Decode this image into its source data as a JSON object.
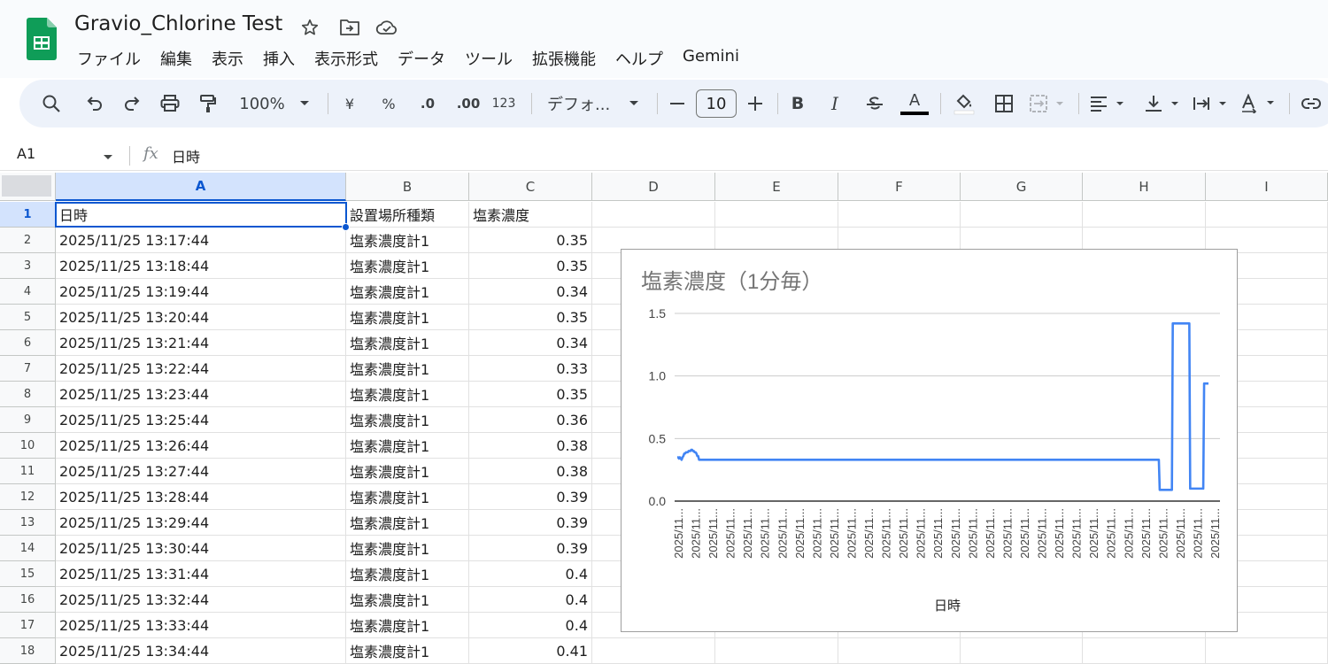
{
  "app": {
    "doc_title": "Gravio_Chlorine Test",
    "menu": [
      "ファイル",
      "編集",
      "表示",
      "挿入",
      "表示形式",
      "データ",
      "ツール",
      "拡張機能",
      "ヘルプ",
      "Gemini"
    ],
    "brand_color": "#0f9d58"
  },
  "toolbar": {
    "zoom": "100%",
    "currency": "¥",
    "percent": "%",
    "decimal_decrease": ".0",
    "decimal_increase": ".00",
    "number_format": "123",
    "font_name": "デフォ...",
    "font_size": "10",
    "bold": "B",
    "italic": "I",
    "text_color_glyph": "A",
    "icons": [
      "search-icon",
      "undo-icon",
      "redo-icon",
      "print-icon",
      "paint-format-icon",
      "zoom-caret-icon",
      "font-caret-icon",
      "minus-icon",
      "plus-icon",
      "strikethrough-icon",
      "fill-color-icon",
      "borders-icon",
      "merge-cells-icon",
      "align-icon",
      "valign-icon",
      "text-wrap-icon",
      "text-rotate-icon",
      "link-icon"
    ]
  },
  "formula_bar": {
    "name_box": "A1",
    "fx": "fx",
    "formula": "日時"
  },
  "sheet": {
    "columns": [
      "A",
      "B",
      "C",
      "D",
      "E",
      "F",
      "G",
      "H",
      "I"
    ],
    "rows": [
      {
        "num": "1",
        "a": "日時",
        "b": "設置場所種類",
        "c": "塩素濃度"
      },
      {
        "num": "2",
        "a": "2025/11/25 13:17:44",
        "b": "塩素濃度計1",
        "c": "0.35"
      },
      {
        "num": "3",
        "a": "2025/11/25 13:18:44",
        "b": "塩素濃度計1",
        "c": "0.35"
      },
      {
        "num": "4",
        "a": "2025/11/25 13:19:44",
        "b": "塩素濃度計1",
        "c": "0.34"
      },
      {
        "num": "5",
        "a": "2025/11/25 13:20:44",
        "b": "塩素濃度計1",
        "c": "0.35"
      },
      {
        "num": "6",
        "a": "2025/11/25 13:21:44",
        "b": "塩素濃度計1",
        "c": "0.34"
      },
      {
        "num": "7",
        "a": "2025/11/25 13:22:44",
        "b": "塩素濃度計1",
        "c": "0.33"
      },
      {
        "num": "8",
        "a": "2025/11/25 13:23:44",
        "b": "塩素濃度計1",
        "c": "0.35"
      },
      {
        "num": "9",
        "a": "2025/11/25 13:25:44",
        "b": "塩素濃度計1",
        "c": "0.36"
      },
      {
        "num": "10",
        "a": "2025/11/25 13:26:44",
        "b": "塩素濃度計1",
        "c": "0.38"
      },
      {
        "num": "11",
        "a": "2025/11/25 13:27:44",
        "b": "塩素濃度計1",
        "c": "0.38"
      },
      {
        "num": "12",
        "a": "2025/11/25 13:28:44",
        "b": "塩素濃度計1",
        "c": "0.39"
      },
      {
        "num": "13",
        "a": "2025/11/25 13:29:44",
        "b": "塩素濃度計1",
        "c": "0.39"
      },
      {
        "num": "14",
        "a": "2025/11/25 13:30:44",
        "b": "塩素濃度計1",
        "c": "0.39"
      },
      {
        "num": "15",
        "a": "2025/11/25 13:31:44",
        "b": "塩素濃度計1",
        "c": "0.4"
      },
      {
        "num": "16",
        "a": "2025/11/25 13:32:44",
        "b": "塩素濃度計1",
        "c": "0.4"
      },
      {
        "num": "17",
        "a": "2025/11/25 13:33:44",
        "b": "塩素濃度計1",
        "c": "0.4"
      },
      {
        "num": "18",
        "a": "2025/11/25 13:34:44",
        "b": "塩素濃度計1",
        "c": "0.41"
      }
    ]
  },
  "chart_data": {
    "type": "line",
    "title": "塩素濃度（1分毎）",
    "xlabel": "日時",
    "ylabel": "",
    "ylim": [
      0,
      1.5
    ],
    "yticks": [
      "0.0",
      "0.5",
      "1.0",
      "1.5"
    ],
    "grid": true,
    "legend": "none",
    "x_tick_label": "2025/11...",
    "x_tick_count": 32,
    "line_color": "#4285f4",
    "series": [
      {
        "values": [
          0.35,
          0.35,
          0.34,
          0.35,
          0.34,
          0.33,
          0.35,
          0.36,
          0.38,
          0.38,
          0.39,
          0.39,
          0.39,
          0.4,
          0.4,
          0.4,
          0.41,
          0.41,
          0.4,
          0.4,
          0.39,
          0.39,
          0.38,
          0.36,
          0.36,
          0.33,
          0.33,
          0.33,
          0.33,
          0.33,
          0.33,
          0.33,
          0.33,
          0.33,
          0.33,
          0.33,
          0.33,
          0.33,
          0.33,
          0.33,
          0.33,
          0.33,
          0.33,
          0.33,
          0.33,
          0.33,
          0.33,
          0.33,
          0.33,
          0.33,
          0.33,
          0.33,
          0.33,
          0.33,
          0.33,
          0.33,
          0.33,
          0.33,
          0.33,
          0.33,
          0.33,
          0.33,
          0.33,
          0.33,
          0.33,
          0.33,
          0.33,
          0.33,
          0.33,
          0.33,
          0.33,
          0.33,
          0.33,
          0.33,
          0.33,
          0.33,
          0.33,
          0.33,
          0.33,
          0.33,
          0.33,
          0.33,
          0.33,
          0.33,
          0.33,
          0.33,
          0.33,
          0.33,
          0.33,
          0.33,
          0.33,
          0.33,
          0.33,
          0.33,
          0.33,
          0.33,
          0.33,
          0.33,
          0.33,
          0.33,
          0.33,
          0.33,
          0.33,
          0.33,
          0.33,
          0.33,
          0.33,
          0.33,
          0.33,
          0.33,
          0.33,
          0.33,
          0.33,
          0.33,
          0.33,
          0.33,
          0.33,
          0.33,
          0.33,
          0.33,
          0.33,
          0.33,
          0.33,
          0.33,
          0.33,
          0.33,
          0.33,
          0.33,
          0.33,
          0.33,
          0.33,
          0.33,
          0.33,
          0.33,
          0.33,
          0.33,
          0.33,
          0.33,
          0.33,
          0.33,
          0.33,
          0.33,
          0.33,
          0.33,
          0.33,
          0.33,
          0.33,
          0.33,
          0.33,
          0.33,
          0.33,
          0.33,
          0.33,
          0.33,
          0.33,
          0.33,
          0.33,
          0.33,
          0.33,
          0.33,
          0.33,
          0.33,
          0.33,
          0.33,
          0.33,
          0.33,
          0.33,
          0.33,
          0.33,
          0.33,
          0.33,
          0.33,
          0.33,
          0.33,
          0.33,
          0.33,
          0.33,
          0.33,
          0.33,
          0.33,
          0.33,
          0.33,
          0.33,
          0.33,
          0.33,
          0.33,
          0.33,
          0.33,
          0.33,
          0.33,
          0.33,
          0.33,
          0.33,
          0.33,
          0.33,
          0.33,
          0.33,
          0.33,
          0.33,
          0.33,
          0.33,
          0.33,
          0.33,
          0.33,
          0.33,
          0.33,
          0.33,
          0.33,
          0.33,
          0.33,
          0.33,
          0.33,
          0.33,
          0.33,
          0.33,
          0.33,
          0.33,
          0.33,
          0.33,
          0.33,
          0.33,
          0.33,
          0.33,
          0.33,
          0.33,
          0.33,
          0.33,
          0.33,
          0.33,
          0.33,
          0.33,
          0.33,
          0.33,
          0.33,
          0.33,
          0.33,
          0.33,
          0.33,
          0.33,
          0.33,
          0.33,
          0.33,
          0.33,
          0.33,
          0.33,
          0.33,
          0.33,
          0.33,
          0.33,
          0.33,
          0.33,
          0.33,
          0.33,
          0.33,
          0.33,
          0.33,
          0.33,
          0.33,
          0.33,
          0.33,
          0.33,
          0.33,
          0.33,
          0.33,
          0.33,
          0.33,
          0.33,
          0.33,
          0.33,
          0.33,
          0.33,
          0.33,
          0.33,
          0.33,
          0.33,
          0.33,
          0.33,
          0.33,
          0.33,
          0.33,
          0.33,
          0.33,
          0.33,
          0.33,
          0.33,
          0.33,
          0.33,
          0.33,
          0.33,
          0.33,
          0.33,
          0.33,
          0.33,
          0.33,
          0.33,
          0.33,
          0.33,
          0.33,
          0.33,
          0.33,
          0.33,
          0.33,
          0.33,
          0.33,
          0.33,
          0.33,
          0.33,
          0.33,
          0.33,
          0.33,
          0.33,
          0.33,
          0.33,
          0.33,
          0.33,
          0.33,
          0.33,
          0.33,
          0.33,
          0.33,
          0.33,
          0.33,
          0.33,
          0.33,
          0.33,
          0.33,
          0.33,
          0.33,
          0.33,
          0.33,
          0.33,
          0.33,
          0.33,
          0.33,
          0.33,
          0.33,
          0.33,
          0.33,
          0.33,
          0.33,
          0.33,
          0.33,
          0.33,
          0.33,
          0.33,
          0.33,
          0.33,
          0.33,
          0.33,
          0.33,
          0.33,
          0.33,
          0.33,
          0.33,
          0.33,
          0.33,
          0.33,
          0.33,
          0.33,
          0.33,
          0.33,
          0.33,
          0.33,
          0.33,
          0.33,
          0.33,
          0.33,
          0.33,
          0.33,
          0.33,
          0.33,
          0.33,
          0.33,
          0.33,
          0.33,
          0.33,
          0.33,
          0.33,
          0.33,
          0.33,
          0.33,
          0.33,
          0.33,
          0.33,
          0.33,
          0.33,
          0.33,
          0.33,
          0.33,
          0.33,
          0.33,
          0.33,
          0.33,
          0.33,
          0.33,
          0.33,
          0.33,
          0.33,
          0.33,
          0.33,
          0.33,
          0.33,
          0.33,
          0.33,
          0.33,
          0.33,
          0.33,
          0.33,
          0.33,
          0.33,
          0.33,
          0.33,
          0.33,
          0.33,
          0.33,
          0.33,
          0.33,
          0.33,
          0.33,
          0.33,
          0.33,
          0.33,
          0.33,
          0.33,
          0.33,
          0.33,
          0.33,
          0.33,
          0.33,
          0.33,
          0.33,
          0.33,
          0.33,
          0.33,
          0.33,
          0.33,
          0.33,
          0.33,
          0.33,
          0.33,
          0.33,
          0.33,
          0.33,
          0.33,
          0.33,
          0.33,
          0.33,
          0.33,
          0.33,
          0.33,
          0.33,
          0.33,
          0.33,
          0.33,
          0.33,
          0.33,
          0.33,
          0.33,
          0.33,
          0.33,
          0.33,
          0.33,
          0.33,
          0.33,
          0.33,
          0.33,
          0.33,
          0.33,
          0.33,
          0.33,
          0.33,
          0.33,
          0.33,
          0.33,
          0.33,
          0.33,
          0.33,
          0.33,
          0.33,
          0.33,
          0.33,
          0.33,
          0.33,
          0.33,
          0.33,
          0.33,
          0.33,
          0.33,
          0.33,
          0.33,
          0.33,
          0.33,
          0.33,
          0.33,
          0.33,
          0.33,
          0.33,
          0.33,
          0.33,
          0.33,
          0.33,
          0.33,
          0.33,
          0.33,
          0.33,
          0.33,
          0.33,
          0.33,
          0.33,
          0.33,
          0.33,
          0.33,
          0.33,
          0.33,
          0.33,
          0.33,
          0.33,
          0.33,
          0.33,
          0.33,
          0.33,
          0.33,
          0.33,
          0.33,
          0.33,
          0.33,
          0.33,
          0.33,
          0.33,
          0.33,
          0.33,
          0.33,
          0.33,
          0.33,
          0.33,
          0.33,
          0.33,
          0.33,
          0.33,
          0.33,
          0.33,
          0.33,
          0.33,
          0.33,
          0.33,
          0.33,
          0.33,
          0.33,
          0.33,
          0.33,
          0.33,
          0.33,
          0.33,
          0.33,
          0.09,
          0.09,
          0.09,
          0.09,
          0.09,
          0.09,
          0.09,
          0.09,
          0.09,
          0.09,
          0.09,
          0.09,
          0.09,
          0.09,
          0.09,
          1.42,
          1.42,
          1.42,
          1.42,
          1.42,
          1.42,
          1.42,
          1.42,
          1.42,
          1.42,
          1.42,
          1.42,
          1.42,
          1.42,
          1.42,
          1.42,
          1.42,
          1.42,
          1.42,
          1.42,
          0.1,
          0.1,
          0.1,
          0.1,
          0.1,
          0.1,
          0.1,
          0.1,
          0.1,
          0.1,
          0.1,
          0.1,
          0.1,
          0.1,
          0.1,
          0.1,
          0.94,
          0.94,
          0.94,
          0.94,
          0.94,
          0.94
        ]
      }
    ]
  }
}
